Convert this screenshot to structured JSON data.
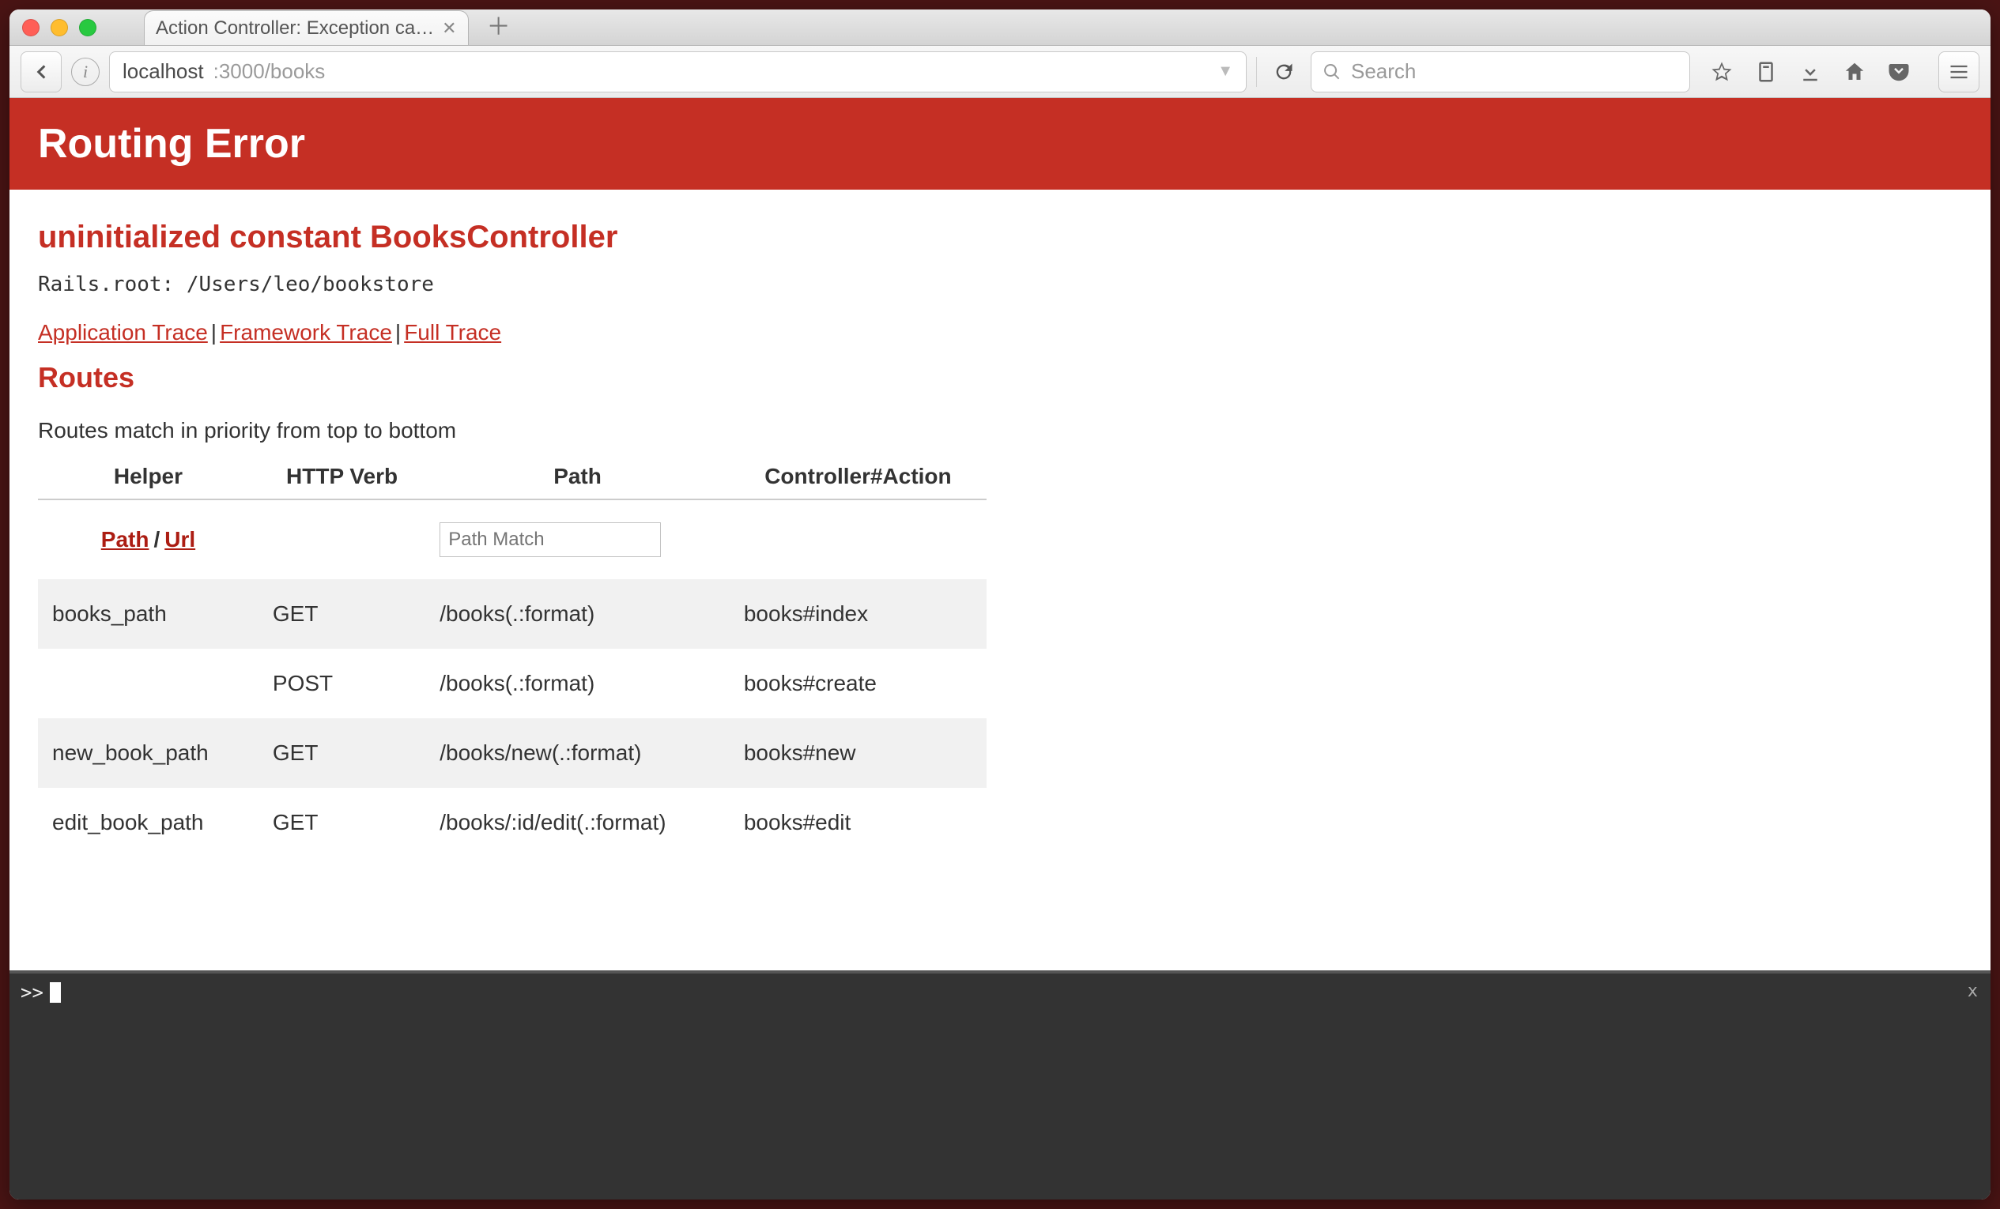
{
  "browser": {
    "tab_title": "Action Controller: Exception ca…",
    "url_host": "localhost",
    "url_rest": ":3000/books",
    "search_placeholder": "Search"
  },
  "page": {
    "banner_title": "Routing Error",
    "error_message": "uninitialized constant BooksController",
    "rails_root": "Rails.root: /Users/leo/bookstore",
    "trace_links": {
      "app": "Application Trace",
      "framework": "Framework Trace",
      "full": "Full Trace"
    },
    "routes_heading": "Routes",
    "routes_note": "Routes match in priority from top to bottom",
    "columns": {
      "helper": "Helper",
      "verb": "HTTP Verb",
      "path": "Path",
      "action": "Controller#Action"
    },
    "filter_row": {
      "path_label": "Path",
      "url_label": "Url",
      "path_input_placeholder": "Path Match"
    },
    "routes": [
      {
        "helper": "books_path",
        "verb": "GET",
        "path": "/books(.:format)",
        "action": "books#index"
      },
      {
        "helper": "",
        "verb": "POST",
        "path": "/books(.:format)",
        "action": "books#create"
      },
      {
        "helper": "new_book_path",
        "verb": "GET",
        "path": "/books/new(.:format)",
        "action": "books#new"
      },
      {
        "helper": "edit_book_path",
        "verb": "GET",
        "path": "/books/:id/edit(.:format)",
        "action": "books#edit"
      }
    ]
  },
  "console": {
    "prompt": ">>",
    "close_label": "x"
  }
}
